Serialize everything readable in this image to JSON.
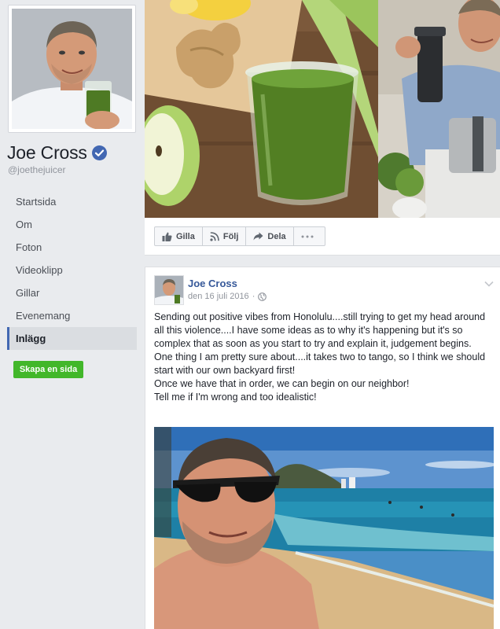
{
  "page": {
    "name": "Joe Cross",
    "handle": "@joethejuicer",
    "verified": true
  },
  "sidebar": {
    "items": [
      {
        "label": "Startsida",
        "active": false
      },
      {
        "label": "Om",
        "active": false
      },
      {
        "label": "Foton",
        "active": false
      },
      {
        "label": "Videoklipp",
        "active": false
      },
      {
        "label": "Gillar",
        "active": false
      },
      {
        "label": "Evenemang",
        "active": false
      },
      {
        "label": "Inlägg",
        "active": true
      }
    ],
    "create_page_label": "Skapa en sida"
  },
  "cover": {
    "actions": [
      {
        "label": "Gilla",
        "icon": "thumbs-up-icon"
      },
      {
        "label": "Följ",
        "icon": "rss-icon"
      },
      {
        "label": "Dela",
        "icon": "share-arrow-icon"
      }
    ],
    "more_icon": "more-dots-icon"
  },
  "post": {
    "author": "Joe Cross",
    "date": "den 16 juli 2016",
    "separator": "·",
    "privacy_icon": "globe-icon",
    "text_lines": [
      "Sending out positive vibes from Honolulu....still trying to get my head around all this violence....I have some ideas as to why it's happening but it's so complex that as soon as you start to try and explain it, judgement begins.",
      "One thing I am pretty sure about....it takes two to tango, so I think we should start with our own backyard first!",
      "Once we have that in order, we can begin on our neighbor!",
      "Tell me if I'm wrong and too idealistic!"
    ]
  },
  "colors": {
    "background": "#e9ebee",
    "link_blue": "#365899",
    "verified_blue": "#4267b2",
    "create_green": "#42b72a"
  }
}
